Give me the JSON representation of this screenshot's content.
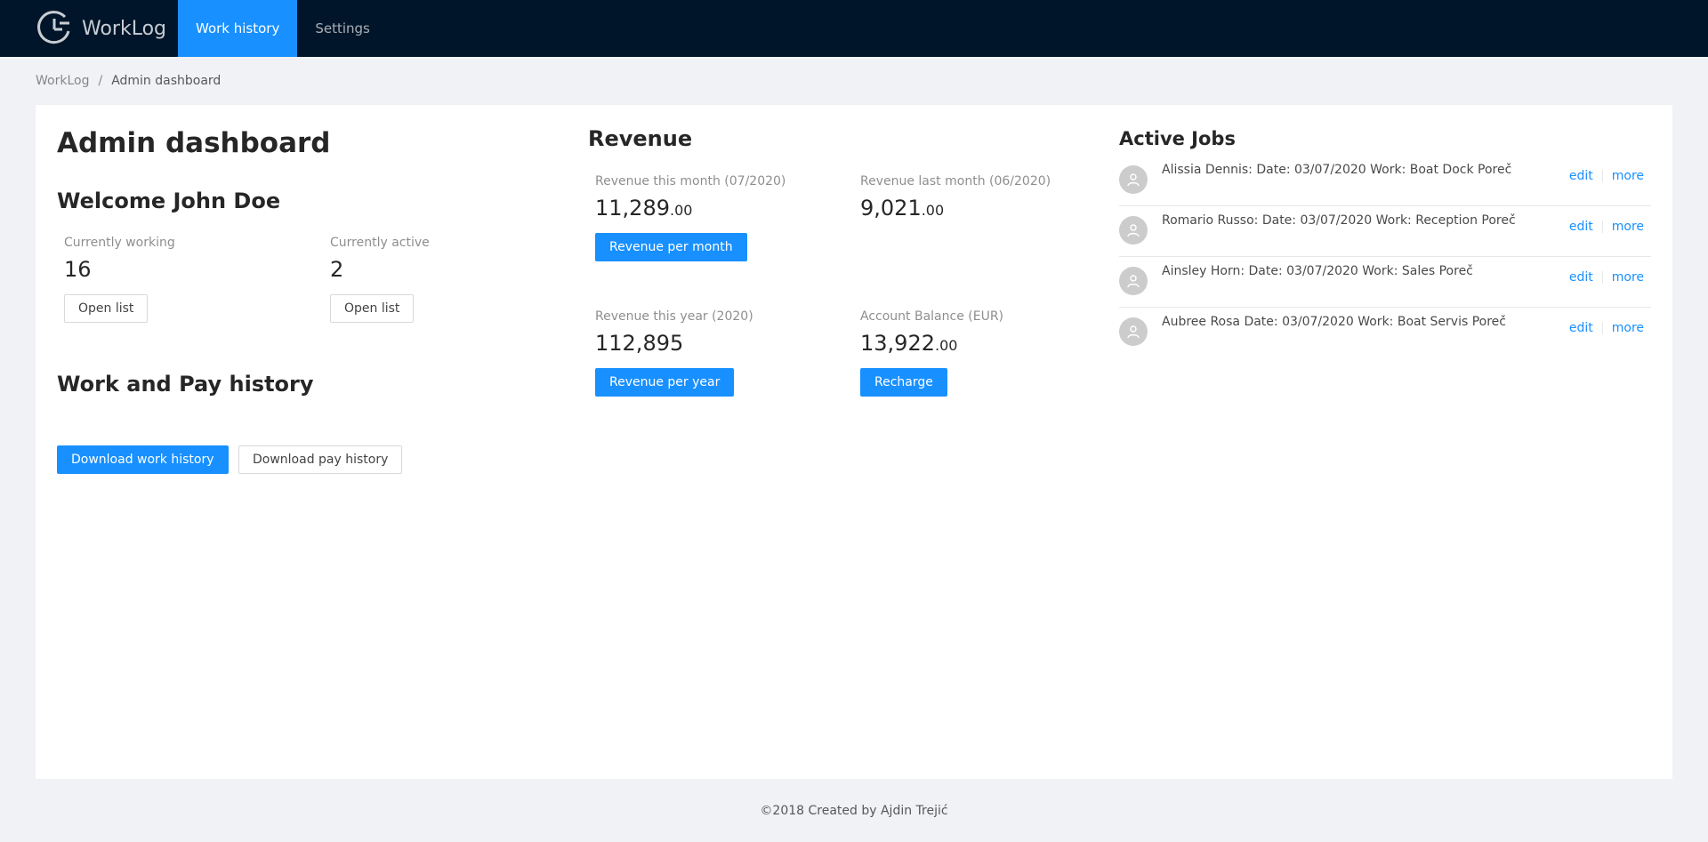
{
  "app": {
    "name": "WorkLog"
  },
  "nav": {
    "items": [
      {
        "label": "Work history"
      },
      {
        "label": "Settings"
      }
    ]
  },
  "breadcrumb": {
    "root": "WorkLog",
    "separator": "/",
    "current": "Admin dashboard"
  },
  "dashboard": {
    "title": "Admin dashboard",
    "welcome": "Welcome John Doe",
    "stats": {
      "working": {
        "label": "Currently working",
        "value": "16",
        "button": "Open list"
      },
      "active": {
        "label": "Currently active",
        "value": "2",
        "button": "Open list"
      }
    },
    "history": {
      "title": "Work and Pay history",
      "download_work": "Download work history",
      "download_pay": "Download pay history"
    }
  },
  "revenue": {
    "title": "Revenue",
    "this_month": {
      "label": "Revenue this month (07/2020)",
      "value": "11,289",
      "suffix": ".00",
      "button": "Revenue per month"
    },
    "last_month": {
      "label": "Revenue last month (06/2020)",
      "value": "9,021",
      "suffix": ".00"
    },
    "this_year": {
      "label": "Revenue this year (2020)",
      "value": "112,895",
      "button": "Revenue per year"
    },
    "balance": {
      "label": "Account Balance (EUR)",
      "value": "13,922",
      "suffix": ".00",
      "button": "Recharge"
    }
  },
  "active_jobs": {
    "title": "Active Jobs",
    "edit_label": "edit",
    "more_label": "more",
    "items": [
      {
        "text": "Alissia Dennis: Date: 03/07/2020 Work: Boat Dock Poreč"
      },
      {
        "text": "Romario Russo: Date: 03/07/2020 Work: Reception Poreč"
      },
      {
        "text": "Ainsley Horn: Date: 03/07/2020 Work: Sales Poreč"
      },
      {
        "text": "Aubree Rosa Date: 03/07/2020 Work: Boat Servis Poreč"
      }
    ]
  },
  "footer": {
    "text": "©2018 Created by Ajdin Trejić"
  },
  "colors": {
    "header_bg": "#001529",
    "primary": "#1890ff",
    "page_bg": "#f0f2f5"
  }
}
